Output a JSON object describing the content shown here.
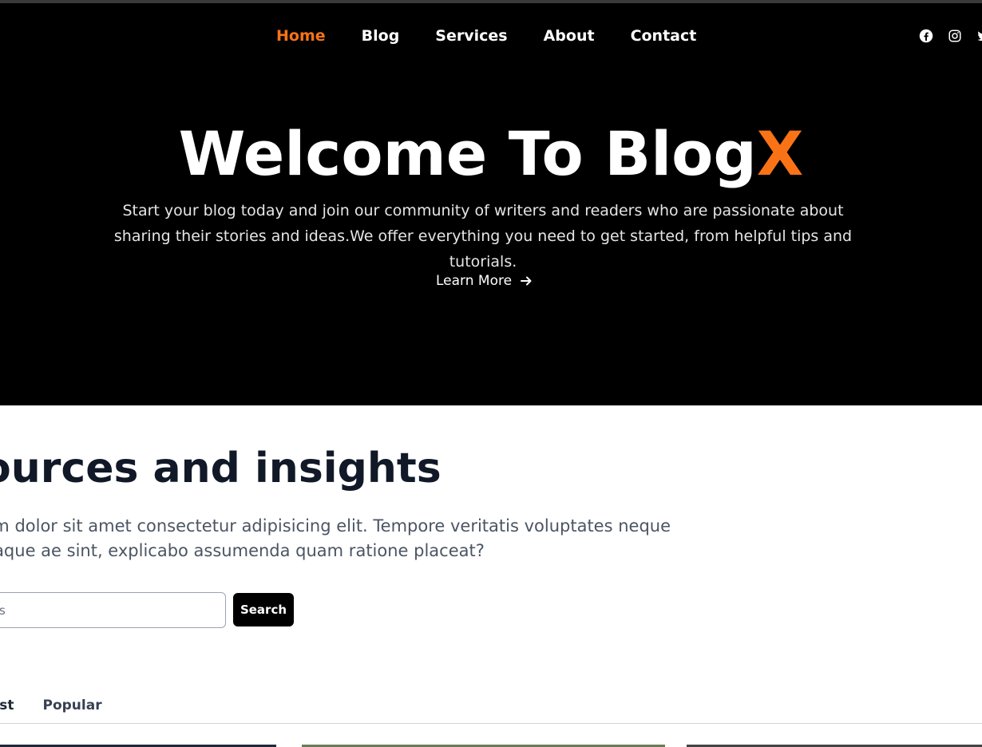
{
  "nav": {
    "items": [
      {
        "label": "Home",
        "active": true
      },
      {
        "label": "Blog"
      },
      {
        "label": "Services"
      },
      {
        "label": "About"
      },
      {
        "label": "Contact"
      }
    ],
    "socials": [
      "facebook-icon",
      "instagram-icon",
      "twitter-icon"
    ]
  },
  "hero": {
    "title_main": "Welcome To Blog",
    "title_accent": "X",
    "subtitle": "Start your blog today and join our community of writers and readers who are passionate about sharing their stories and ideas.We offer everything you need to get started, from helpful tips and tutorials.",
    "cta_label": "Learn More"
  },
  "resources": {
    "title": "ources and insights",
    "description": "um dolor sit amet consectetur adipisicing elit. Tempore veritatis voluptates neque itaque ae sint, explicabo assumenda quam ratione placeat?",
    "search_placeholder": "s",
    "search_button": "Search",
    "tabs": [
      "west",
      "Popular"
    ]
  },
  "colors": {
    "accent": "#f97316",
    "hero_bg": "#000000",
    "text_dark": "#111827"
  }
}
